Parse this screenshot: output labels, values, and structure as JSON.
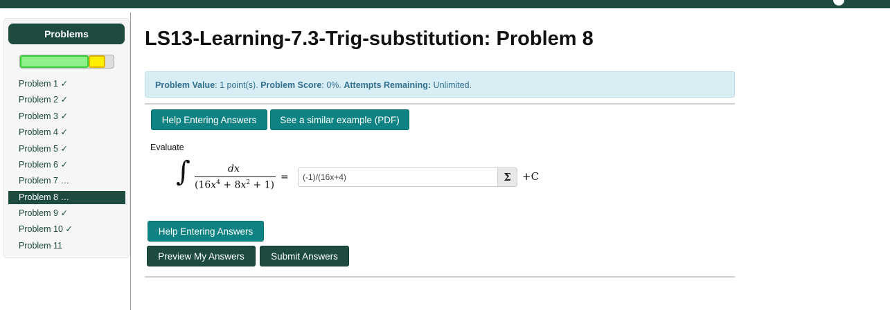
{
  "sidebar": {
    "header": "Problems",
    "progress": {
      "correct_fraction": 0.73,
      "partial_fraction": 0.18
    },
    "problems": [
      {
        "label": "Problem 1 ✓",
        "active": false
      },
      {
        "label": "Problem 2 ✓",
        "active": false
      },
      {
        "label": "Problem 3 ✓",
        "active": false
      },
      {
        "label": "Problem 4 ✓",
        "active": false
      },
      {
        "label": "Problem 5 ✓",
        "active": false
      },
      {
        "label": "Problem 6 ✓",
        "active": false
      },
      {
        "label": "Problem 7 …",
        "active": false
      },
      {
        "label": "Problem 8 …",
        "active": true
      },
      {
        "label": "Problem 9 ✓",
        "active": false
      },
      {
        "label": "Problem 10 ✓",
        "active": false
      },
      {
        "label": "Problem 11",
        "active": false
      }
    ]
  },
  "page": {
    "title": "LS13-Learning-7.3-Trig-substitution: Problem 8"
  },
  "status": {
    "value_label": "Problem Value",
    "value_text": ": 1 point(s). ",
    "score_label": "Problem Score",
    "score_text": ": 0%. ",
    "attempts_label": "Attempts Remaining:",
    "attempts_text": " Unlimited."
  },
  "toolbar": {
    "help_label": "Help Entering Answers",
    "example_label": "See a similar example (PDF)"
  },
  "problem": {
    "prompt": "Evaluate",
    "integral_sign": "∫",
    "numerator": "dx",
    "denominator_html_parts": [
      "(16",
      "x",
      "4",
      " + 8",
      "x",
      "2",
      " + 1)"
    ],
    "equals": "=",
    "answer_value": "(-1)/(16x+4)",
    "sigma_label": "Σ",
    "constant": "+C"
  },
  "actions": {
    "help_label": "Help Entering Answers",
    "preview_label": "Preview My Answers",
    "submit_label": "Submit Answers"
  },
  "colors": {
    "brand": "#1d4b3f",
    "teal": "#0f8383",
    "alert_bg": "#d9edf5",
    "alert_text": "#31708f"
  }
}
